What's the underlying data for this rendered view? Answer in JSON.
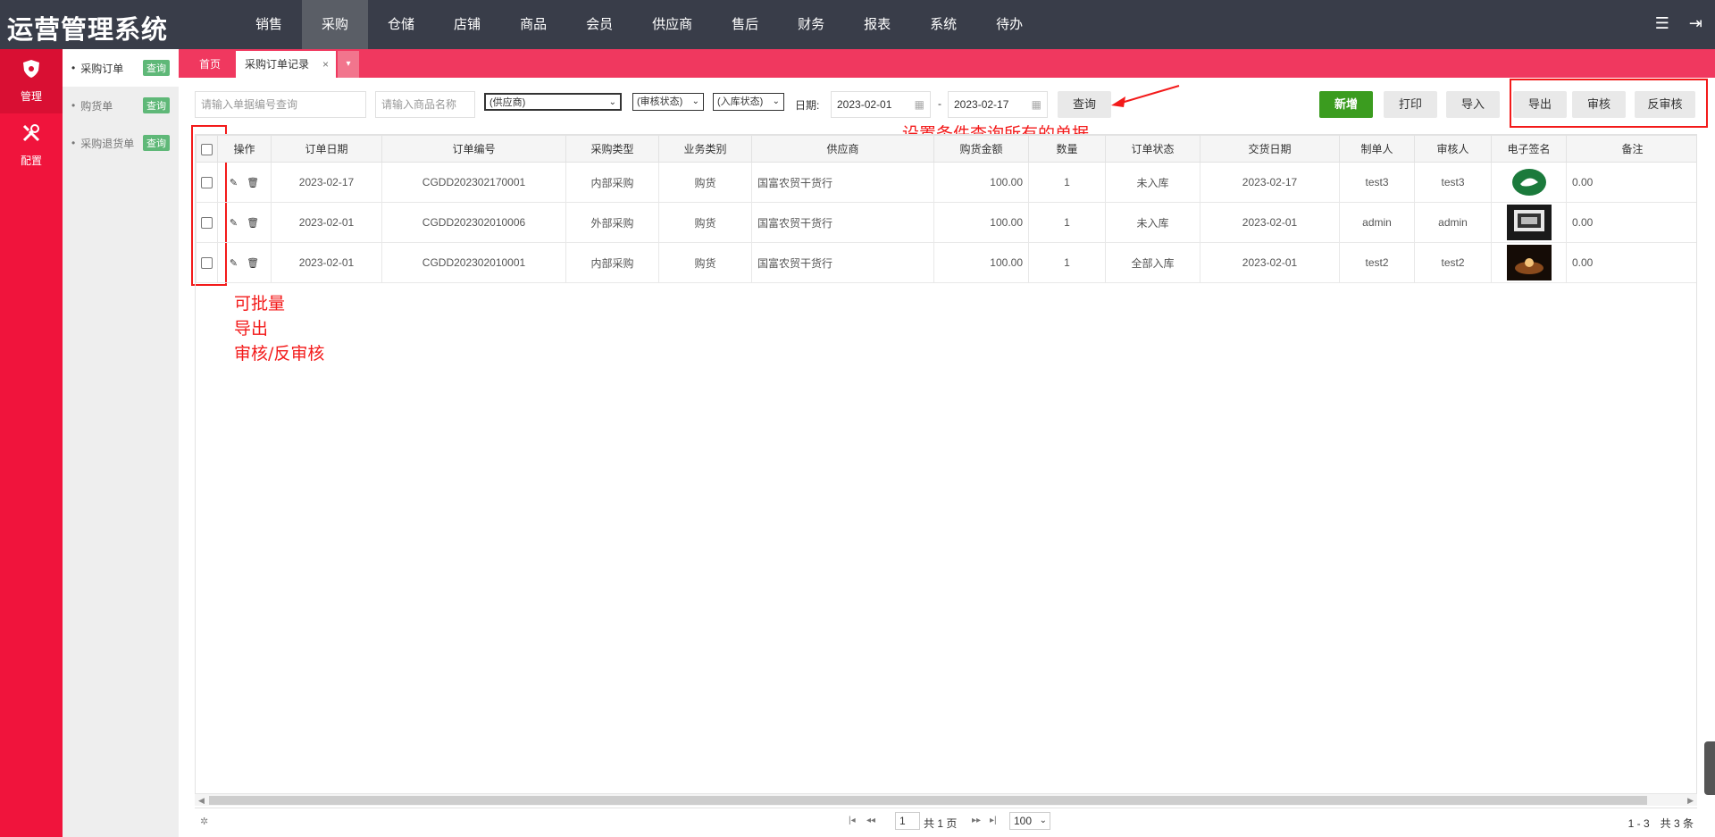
{
  "app": {
    "title": "运营管理系统"
  },
  "topnav": {
    "items": [
      "销售",
      "采购",
      "仓储",
      "店铺",
      "商品",
      "会员",
      "供应商",
      "售后",
      "财务",
      "报表",
      "系统",
      "待办"
    ],
    "active_index": 1
  },
  "leftbar": {
    "items": [
      {
        "label": "管理",
        "icon": "shield-icon"
      },
      {
        "label": "配置",
        "icon": "tools-icon"
      }
    ]
  },
  "submenu": {
    "items": [
      {
        "label": "采购订单",
        "badge": "查询"
      },
      {
        "label": "购货单",
        "badge": "查询"
      },
      {
        "label": "采购退货单",
        "badge": "查询"
      }
    ]
  },
  "tabs": {
    "home": "首页",
    "active": "采购订单记录",
    "close": "×",
    "more": "▾"
  },
  "toolbar": {
    "order_no_placeholder": "请输入单据编号查询",
    "product_placeholder": "请输入商品名称",
    "supplier_select": "(供应商)",
    "audit_select": "(审核状态)",
    "stock_select": "(入库状态)",
    "date_label": "日期:",
    "date_from": "2023-02-01",
    "date_to": "2023-02-17",
    "date_sep": "-",
    "query_button": "查询",
    "new_button": "新增",
    "print_button": "打印",
    "import_button": "导入",
    "export_button": "导出",
    "audit_button": "审核",
    "unaudit_button": "反审核"
  },
  "annotations": {
    "query_note": "设置条件查询所有的单据",
    "batch_line1": "可批量",
    "batch_line2": "导出",
    "batch_line3": "审核/反审核"
  },
  "table": {
    "headers": [
      "",
      "操作",
      "订单日期",
      "订单编号",
      "采购类型",
      "业务类别",
      "供应商",
      "购货金额",
      "数量",
      "订单状态",
      "交货日期",
      "制单人",
      "审核人",
      "电子签名",
      "备注"
    ],
    "rows": [
      [
        "2023-02-17",
        "CGDD202302170001",
        "内部采购",
        "购货",
        "国富农贸干货行",
        "100.00",
        "1",
        "未入库",
        "2023-02-17",
        "test3",
        "test3",
        "0.00"
      ],
      [
        "2023-02-01",
        "CGDD202302010006",
        "外部采购",
        "购货",
        "国富农贸干货行",
        "100.00",
        "1",
        "未入库",
        "2023-02-01",
        "admin",
        "admin",
        "0.00"
      ],
      [
        "2023-02-01",
        "CGDD202302010001",
        "内部采购",
        "购货",
        "国富农贸干货行",
        "100.00",
        "1",
        "全部入库",
        "2023-02-01",
        "test2",
        "test2",
        "0.00"
      ]
    ]
  },
  "pager": {
    "page": "1",
    "total_pages": "共 1 页",
    "page_size": "100",
    "info": "1 - 3　共 3 条"
  }
}
